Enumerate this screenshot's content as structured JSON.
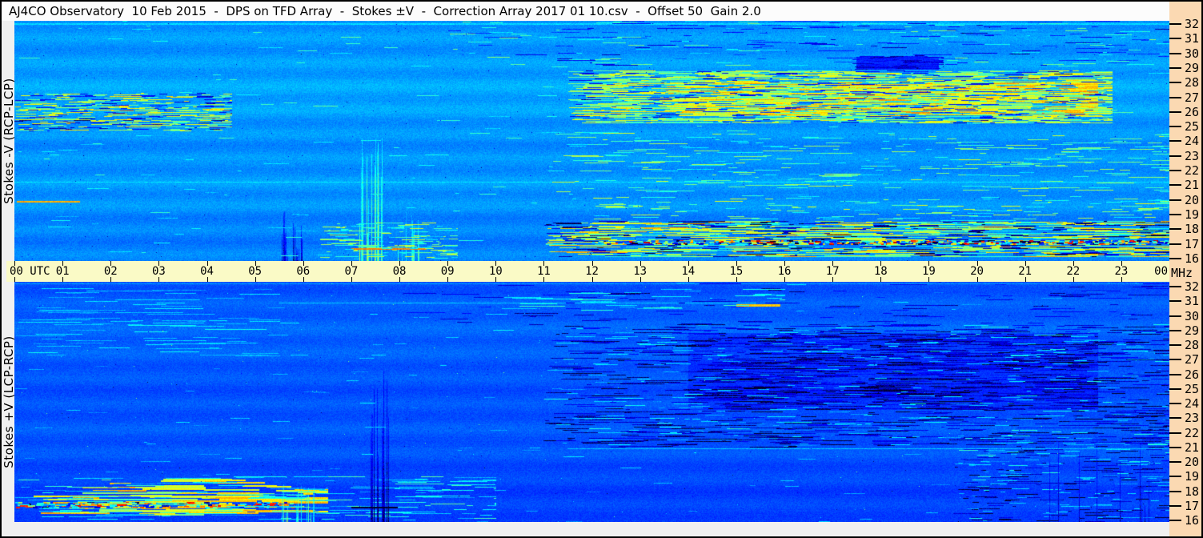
{
  "title": "AJ4CO Observatory  10 Feb 2015  -  DPS on TFD Array  -  Stokes ±V  -  Correction Array 2017 01 10.csv  -  Offset 50  Gain 2.0",
  "left_labels": {
    "top": "Stokes -V (RCP-LCP)",
    "bottom": "Stokes +V (LCP-RCP)"
  },
  "time_axis": {
    "hours": [
      "00",
      "01",
      "02",
      "03",
      "04",
      "05",
      "06",
      "07",
      "08",
      "09",
      "10",
      "11",
      "12",
      "13",
      "14",
      "15",
      "16",
      "17",
      "18",
      "19",
      "20",
      "21",
      "22",
      "23",
      "00"
    ],
    "utc_label": "UTC",
    "mhz_label": "MHz"
  },
  "freq_axis": {
    "labels": [
      32,
      31,
      30,
      29,
      28,
      27,
      26,
      25,
      24,
      23,
      22,
      21,
      20,
      19,
      18,
      17,
      16
    ]
  },
  "colors": {
    "frame": "#000000",
    "title_bg": "#FCFCFC",
    "title_text": "#000000",
    "left_strip": "#F0F0F0",
    "time_band": "#FAFAC6",
    "freq_rail": "#FBD9B2",
    "top_panel_base": "#1E96E6",
    "bottom_panel_base": "#0A5AE6"
  },
  "chart_data": {
    "type": "heatmap",
    "title": "Dual-channel dynamic spectrum, Stokes ±V, 10 Feb 2015",
    "colormap": "jet",
    "x": {
      "label": "UTC",
      "range": [
        0,
        24
      ],
      "tick_interval": 1,
      "units": "hours"
    },
    "y": {
      "label": "MHz",
      "range": [
        16,
        32
      ],
      "tick_interval": 1,
      "units": "MHz"
    },
    "panels": [
      {
        "id": "stokes-minus-v",
        "label": "Stokes -V (RCP-LCP)",
        "seed": 42,
        "base": 0.27,
        "noise": 0.05,
        "banding": {
          "a": [
            0.015,
            0.008,
            0.014
          ],
          "f": [
            0.21,
            0.052,
            0.011
          ],
          "jitter": 0.006
        },
        "features": [
          {
            "type": "hline",
            "t": [
              0,
              24
            ],
            "f": 31.85,
            "v": 0.34,
            "w": 2
          },
          {
            "type": "hline",
            "t": [
              0,
              24
            ],
            "f": 21.3,
            "v": 0.33,
            "w": 1
          },
          {
            "type": "hstreaks",
            "t": [
              0,
              4.5
            ],
            "f": [
              24.7,
              27.2
            ],
            "n": 240,
            "len": [
              0.03,
              0.6
            ],
            "v": [
              0.42,
              0.66
            ],
            "w": 1
          },
          {
            "type": "hstreaks",
            "t": [
              0,
              4.5
            ],
            "f": [
              24.7,
              27.2
            ],
            "n": 110,
            "len": [
              0.03,
              0.35
            ],
            "v": [
              0.04,
              0.15
            ],
            "w": 1
          },
          {
            "type": "hline",
            "t": [
              0.05,
              1.35
            ],
            "f": 20.0,
            "v": 0.7,
            "w": 2
          },
          {
            "type": "hstreaks",
            "t": [
              11.5,
              22.8
            ],
            "f": [
              25.2,
              28.7
            ],
            "n": 1200,
            "len": [
              0.05,
              1.1
            ],
            "v": [
              0.4,
              0.64
            ],
            "w": 1
          },
          {
            "type": "hstreaks",
            "t": [
              13.5,
              22.5
            ],
            "f": [
              25.7,
              27.9
            ],
            "n": 600,
            "len": [
              0.05,
              0.9
            ],
            "v": [
              0.48,
              0.72
            ],
            "w": 1
          },
          {
            "type": "hstreaks",
            "t": [
              11.5,
              22.8
            ],
            "f": [
              25.2,
              28.7
            ],
            "n": 260,
            "len": [
              0.04,
              0.5
            ],
            "v": [
              0.05,
              0.18
            ],
            "w": 1
          },
          {
            "type": "hstreaks",
            "t": [
              11,
              24
            ],
            "f": [
              16.3,
              18.7
            ],
            "n": 650,
            "len": [
              0.05,
              1.4
            ],
            "v": [
              0.38,
              0.72
            ],
            "w": 1
          },
          {
            "type": "hstreaks",
            "t": [
              11,
              24
            ],
            "f": [
              16.3,
              18.7
            ],
            "n": 280,
            "len": [
              0.04,
              0.6
            ],
            "v": [
              0.0,
              0.12
            ],
            "w": 1
          },
          {
            "type": "hstreaks",
            "t": [
              12,
              24
            ],
            "f": [
              17.15,
              17.4
            ],
            "n": 420,
            "len": [
              0.02,
              0.12
            ],
            "v": [
              0.0,
              1.0
            ],
            "w": 2
          },
          {
            "type": "hstreaks",
            "t": [
              11,
              24
            ],
            "f": [
              20.6,
              24.6
            ],
            "n": 230,
            "len": [
              0.05,
              0.8
            ],
            "v": [
              0.36,
              0.56
            ],
            "w": 1
          },
          {
            "type": "hstreaks",
            "t": [
              12,
              24
            ],
            "f": [
              18.8,
              20.4
            ],
            "n": 120,
            "len": [
              0.05,
              0.6
            ],
            "v": [
              0.36,
              0.6
            ],
            "w": 1
          },
          {
            "type": "patch",
            "t": [
              17.5,
              19.2
            ],
            "f": [
              28.8,
              29.6
            ],
            "dv": -0.13
          },
          {
            "type": "hstreaks",
            "t": [
              17.4,
              19.3
            ],
            "f": [
              28.8,
              29.7
            ],
            "n": 70,
            "len": [
              0.06,
              0.5
            ],
            "v": [
              0.04,
              0.12
            ],
            "w": 1
          },
          {
            "type": "vstreaks",
            "t": [
              7.15,
              7.65
            ],
            "f": [
              16,
              24.5
            ],
            "n": 24,
            "v": [
              0.36,
              0.6
            ]
          },
          {
            "type": "vstreaks",
            "t": [
              7.9,
              8.4
            ],
            "f": [
              16,
              19.5
            ],
            "n": 10,
            "v": [
              0.34,
              0.5
            ]
          },
          {
            "type": "vstreaks",
            "t": [
              5.55,
              6.0
            ],
            "f": [
              16,
              19.5
            ],
            "n": 14,
            "v": [
              0.05,
              0.14
            ]
          },
          {
            "type": "hline",
            "t": [
              7.0,
              8.55
            ],
            "f": 16.85,
            "v": 0.76,
            "w": 2
          },
          {
            "type": "hstreaks",
            "t": [
              6.3,
              9.2
            ],
            "f": [
              16.2,
              18.6
            ],
            "n": 130,
            "len": [
              0.04,
              0.5
            ],
            "v": [
              0.34,
              0.6
            ],
            "w": 1
          },
          {
            "type": "hstreaks",
            "t": [
              0,
              24
            ],
            "f": [
              16,
              32
            ],
            "n": 200,
            "len": [
              0.03,
              0.5
            ],
            "v": [
              0.32,
              0.44
            ],
            "w": 1
          },
          {
            "type": "hstreaks",
            "t": [
              9,
              24
            ],
            "f": [
              29,
              32
            ],
            "n": 120,
            "len": [
              0.05,
              0.8
            ],
            "v": [
              0.05,
              0.2
            ],
            "w": 1
          },
          {
            "type": "hstreaks",
            "t": [
              9,
              24
            ],
            "f": [
              29,
              32
            ],
            "n": 80,
            "len": [
              0.05,
              0.6
            ],
            "v": [
              0.34,
              0.5
            ],
            "w": 1
          },
          {
            "type": "dots",
            "t": [
              0,
              24
            ],
            "f": [
              16,
              32
            ],
            "n": 350,
            "v": [
              0.04,
              0.16
            ]
          }
        ]
      },
      {
        "id": "stokes-plus-v",
        "label": "Stokes +V (LCP-RCP)",
        "seed": 1337,
        "base": 0.205,
        "noise": 0.045,
        "banding": {
          "a": [
            0.012,
            0.007,
            0.012
          ],
          "f": [
            0.2,
            0.047,
            0.012
          ],
          "jitter": 0.006
        },
        "features": [
          {
            "type": "hline",
            "t": [
              0,
              24
            ],
            "f": 31.9,
            "v": 0.28,
            "w": 1
          },
          {
            "type": "hstreaks",
            "t": [
              0,
              5.5
            ],
            "f": [
              27,
              31.6
            ],
            "n": 70,
            "len": [
              0.2,
              1.4
            ],
            "v": [
              0.27,
              0.36
            ],
            "w": 1
          },
          {
            "type": "hstreaks",
            "t": [
              11,
              24
            ],
            "f": [
              21,
              29.2
            ],
            "n": 800,
            "len": [
              0.05,
              1.0
            ],
            "v": [
              0.0,
              0.12
            ],
            "w": 1
          },
          {
            "type": "patch",
            "t": [
              14,
              22.5
            ],
            "f": [
              23.5,
              28.6
            ],
            "dv": -0.035
          },
          {
            "type": "hstreaks",
            "t": [
              14,
              22.5
            ],
            "f": [
              23.5,
              28.6
            ],
            "n": 650,
            "len": [
              0.05,
              0.9
            ],
            "v": [
              0.02,
              0.14
            ],
            "w": 1
          },
          {
            "type": "hstreaks",
            "t": [
              11,
              24
            ],
            "f": [
              21,
              29.2
            ],
            "n": 260,
            "len": [
              0.05,
              0.6
            ],
            "v": [
              0.26,
              0.4
            ],
            "w": 1
          },
          {
            "type": "hline",
            "t": [
              5.5,
              15.4
            ],
            "f": 30.6,
            "v": 0.3,
            "w": 1
          },
          {
            "type": "hline",
            "t": [
              15.0,
              15.9
            ],
            "f": 30.5,
            "v": 0.66,
            "w": 3
          },
          {
            "type": "hstreaks",
            "t": [
              10,
              16
            ],
            "f": [
              30,
              31.6
            ],
            "n": 30,
            "len": [
              0.2,
              1.0
            ],
            "v": [
              0.28,
              0.42
            ],
            "w": 1
          },
          {
            "type": "hstreaks",
            "t": [
              0.3,
              6.5
            ],
            "f": [
              16.4,
              18.9
            ],
            "n": 80,
            "len": [
              0.3,
              2.2
            ],
            "v": [
              0.52,
              0.74
            ],
            "w": 2
          },
          {
            "type": "hstreaks",
            "t": [
              0,
              5.8
            ],
            "f": [
              17.0,
              17.35
            ],
            "n": 220,
            "len": [
              0.02,
              0.15
            ],
            "v": [
              0.0,
              0.9
            ],
            "w": 2
          },
          {
            "type": "hstreaks",
            "t": [
              0,
              10
            ],
            "f": [
              16.2,
              19.2
            ],
            "n": 160,
            "len": [
              0.1,
              1.2
            ],
            "v": [
              0.28,
              0.48
            ],
            "w": 1
          },
          {
            "type": "vstreaks",
            "t": [
              5.5,
              6.25
            ],
            "f": [
              16,
              18.8
            ],
            "n": 16,
            "v": [
              0.34,
              0.58
            ]
          },
          {
            "type": "hline",
            "t": [
              6.0,
              6.18
            ],
            "f": 18.0,
            "v": 0.68,
            "w": 3
          },
          {
            "type": "vstreaks",
            "t": [
              7.4,
              7.78
            ],
            "f": [
              16,
              26.5
            ],
            "n": 12,
            "v": [
              0.02,
              0.1
            ]
          },
          {
            "type": "hline",
            "t": [
              7.0,
              7.95
            ],
            "f": 17.0,
            "v": 0.0,
            "w": 2
          },
          {
            "type": "hstreaks",
            "t": [
              19.5,
              24
            ],
            "f": [
              16,
              22
            ],
            "n": 180,
            "len": [
              0.05,
              0.5
            ],
            "v": [
              0.0,
              0.12
            ],
            "w": 1
          },
          {
            "type": "hstreaks",
            "t": [
              19.5,
              24
            ],
            "f": [
              16,
              22
            ],
            "n": 110,
            "len": [
              0.05,
              0.45
            ],
            "v": [
              0.28,
              0.42
            ],
            "w": 1
          },
          {
            "type": "vstreaks",
            "t": [
              21.5,
              23.7
            ],
            "f": [
              16,
              22
            ],
            "n": 10,
            "v": [
              0.06,
              0.13
            ]
          },
          {
            "type": "hline",
            "t": [
              11.5,
              24
            ],
            "f": 20.9,
            "v": 0.31,
            "w": 1
          },
          {
            "type": "hstreaks",
            "t": [
              0,
              24
            ],
            "f": [
              16,
              32
            ],
            "n": 170,
            "len": [
              0.03,
              0.45
            ],
            "v": [
              0.25,
              0.35
            ],
            "w": 1
          },
          {
            "type": "hstreaks",
            "t": [
              8,
              24
            ],
            "f": [
              29,
              32
            ],
            "n": 90,
            "len": [
              0.1,
              0.9
            ],
            "v": [
              0.04,
              0.14
            ],
            "w": 1
          },
          {
            "type": "dots",
            "t": [
              0,
              24
            ],
            "f": [
              16,
              32
            ],
            "n": 300,
            "v": [
              0.03,
              0.15
            ]
          },
          {
            "type": "dots",
            "t": [
              0,
              24
            ],
            "f": [
              16,
              32
            ],
            "n": 150,
            "v": [
              0.3,
              0.5
            ]
          }
        ]
      }
    ]
  }
}
